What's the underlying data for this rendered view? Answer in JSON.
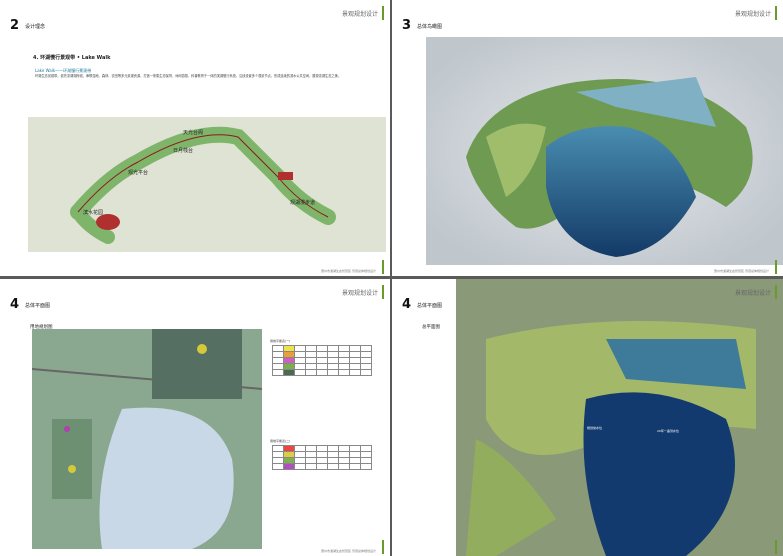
{
  "brand": "景观规划设计",
  "pages": [
    {
      "number": "2",
      "title": "设计理念",
      "footer": "惠州市潼湖生态智慧区·景观总体规划设计"
    },
    {
      "number": "3",
      "title": "总体鸟瞰图",
      "footer": "惠州市潼湖生态智慧区·景观总体规划设计"
    },
    {
      "number": "4",
      "title": "总体平面图",
      "footer": "惠州市潼湖生态智慧区·景观总体规划设计"
    },
    {
      "number": "4",
      "title": "总体平面图",
      "footer": ""
    }
  ],
  "p1": {
    "section": "4. 环湖慢行景观带 • Lake Walk",
    "sub": "Lake Walk——环湖慢行景观带",
    "body": "环湖生态景观带，依托潼湖湖岸线，串联湿地、森林、农田等多元景观资源，打造一条集生态保育、休闲游憩、科普教育于一体的滨湖慢行系统。沿线设置多个观景节点，形成连续的滨水公共空间，展现潼湖生态之美。",
    "labels": [
      "天光台阁",
      "日月栈台",
      "观光平台",
      "湿地驿站",
      "滨水花园",
      "观湖漫步道"
    ]
  },
  "p3": {
    "legend_title": "用地规划图",
    "table1_title": "用地平衡表(一)",
    "table2_title": "用地平衡表(二)"
  },
  "p4": {
    "sublabel": "总平面图",
    "notes": [
      "规划常水位",
      "20年一遇洪水位"
    ]
  }
}
